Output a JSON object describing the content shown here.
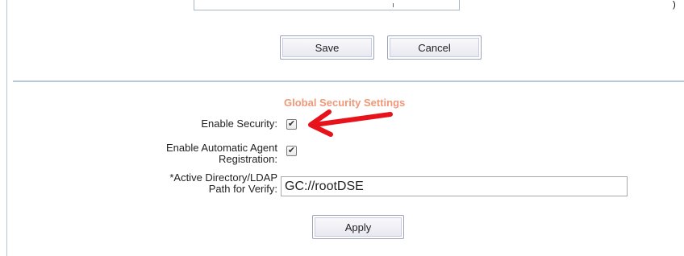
{
  "top_field": {
    "value": ","
  },
  "corner_mark": ")",
  "form_actions": {
    "save_label": "Save",
    "cancel_label": "Cancel"
  },
  "global_security": {
    "title": "Global Security Settings",
    "enable_security": {
      "label": "Enable Security:",
      "checked": true
    },
    "enable_auto_agent_registration": {
      "label_line1": "Enable Automatic Agent",
      "label_line2": "Registration:",
      "checked": true
    },
    "ldap_path": {
      "label_line1": "*Active Directory/LDAP",
      "label_line2": "Path for Verify:",
      "value": "GC://rootDSE"
    },
    "apply_label": "Apply"
  },
  "annotation": {
    "arrow_color": "#e8121b"
  },
  "colors": {
    "section_title": "#f09878",
    "divider": "#b9c8d8"
  }
}
